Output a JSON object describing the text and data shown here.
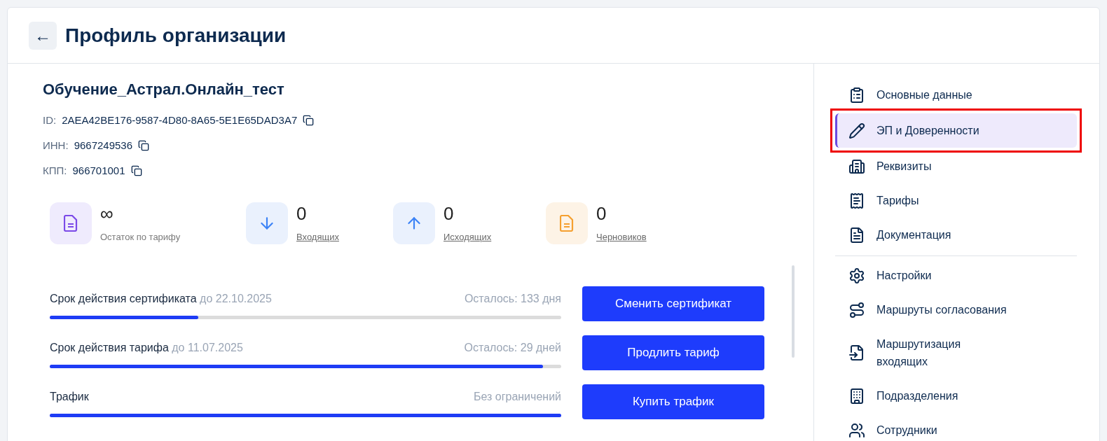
{
  "header": {
    "back": "←",
    "title": "Профиль организации"
  },
  "org": {
    "name": "Обучение_Астрал.Онлайн_тест",
    "fields": [
      {
        "label": "ID:",
        "value": "2AEA42BE176-9587-4D80-8A65-5E1E65DAD3A7"
      },
      {
        "label": "ИНН:",
        "value": "9667249536"
      },
      {
        "label": "КПП:",
        "value": "966701001"
      }
    ]
  },
  "stats": [
    {
      "kind": "tariff",
      "value": "∞",
      "label": "Остаток по тарифу",
      "link": false
    },
    {
      "kind": "incoming",
      "value": "0",
      "label": "Входящих",
      "link": true
    },
    {
      "kind": "outgoing",
      "value": "0",
      "label": "Исходящих",
      "link": true
    },
    {
      "kind": "drafts",
      "value": "0",
      "label": "Черновиков",
      "link": true
    }
  ],
  "limits": [
    {
      "label": "Срок действия сертификата",
      "date": "до 22.10.2025",
      "remaining": "Осталось: 133 дня",
      "level": 0.29,
      "button": "Сменить сертификат"
    },
    {
      "label": "Срок действия тарифа",
      "date": "до 11.07.2025",
      "remaining": "Осталось: 29 дней",
      "level": 0.965,
      "button": "Продлить тариф"
    },
    {
      "label": "Трафик",
      "remaining": "Без ограничений",
      "level": 1.0,
      "button": "Купить трафик"
    }
  ],
  "sidebar": {
    "groups": [
      [
        {
          "kind": "clipboard",
          "label": "Основные данные",
          "selected": false,
          "highlighted": false
        },
        {
          "kind": "pencil",
          "label": "ЭП и Доверенности",
          "selected": true,
          "highlighted": true
        },
        {
          "kind": "building",
          "label": "Реквизиты",
          "selected": false,
          "highlighted": false
        },
        {
          "kind": "receipt",
          "label": "Тарифы",
          "selected": false,
          "highlighted": false
        },
        {
          "kind": "document",
          "label": "Документация",
          "selected": false,
          "highlighted": false
        }
      ],
      [
        {
          "kind": "gear",
          "label": "Настройки",
          "selected": false,
          "highlighted": false
        },
        {
          "kind": "route",
          "label": "Маршруты согласования",
          "selected": false,
          "highlighted": false
        },
        {
          "kind": "file-in",
          "label": "Маршрутизация входящих",
          "selected": false,
          "highlighted": false
        },
        {
          "kind": "grid",
          "label": "Подразделения",
          "selected": false,
          "highlighted": false
        },
        {
          "kind": "users",
          "label": "Сотрудники",
          "selected": false,
          "highlighted": false
        }
      ]
    ]
  }
}
